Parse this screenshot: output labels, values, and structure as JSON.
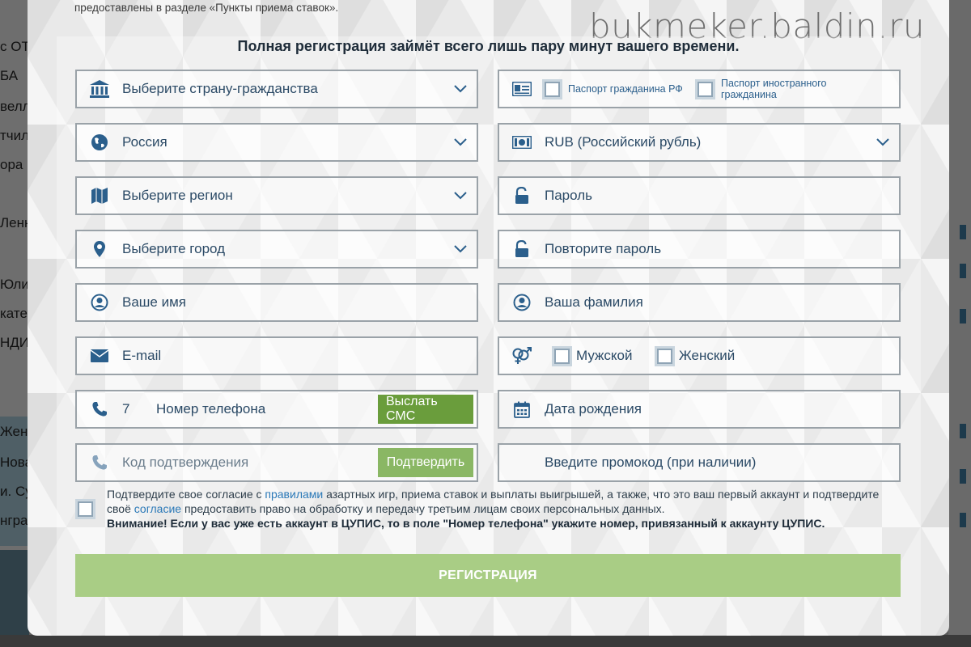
{
  "watermark": "bukmeker.baldin.ru",
  "info_text": "предоставлены в разделе «Пункты приема ставок».",
  "title": "Полная регистрация займёт всего лишь пару минут вашего времени.",
  "background_fragments": [
    "с ОТ",
    "БА",
    "велл",
    "тчил",
    "ора",
    "Ленн",
    "Юли",
    "катер",
    "НДИ",
    "Жен",
    "Нова",
    "и. Су",
    "нгра"
  ],
  "left_fields": {
    "country": "Выберите страну-гражданства",
    "russia": "Россия",
    "region": "Выберите регион",
    "city": "Выберите город",
    "name": "Ваше имя",
    "email": "E-mail",
    "phone_prefix": "7",
    "phone": "Номер телефона",
    "send_sms": "Выслать СМС",
    "code": "Код подтверждения",
    "confirm": "Подтвердить"
  },
  "right_fields": {
    "passport_rf": "Паспорт гражданина РФ",
    "passport_foreign": "Паспорт иностранного гражданина",
    "currency": "RUB (Российский рубль)",
    "password": "Пароль",
    "repeat_password": "Повторите пароль",
    "surname": "Ваша фамилия",
    "male": "Мужской",
    "female": "Женский",
    "birthdate": "Дата рождения",
    "promo": "Введите промокод (при наличии)"
  },
  "agreement": {
    "part1": "Подтвердите свое согласие с ",
    "link_rules": "правилами",
    "part2": " азартных игр, приема ставок и выплаты выигрышей, а также, что это ваш первый аккаунт и подтвердите своё ",
    "link_consent": "согласие",
    "part3": " предоставить право на обработку и передачу третьим лицам своих персональных данных.",
    "warning": "Внимание! Если у вас уже есть аккаунт в ЦУПИС, то в поле \"Номер телефона\" укажите номер, привязанный к аккаунту ЦУПИС."
  },
  "register_button": "РЕГИСТРАЦИЯ",
  "colors": {
    "icon": "#2b5f8c",
    "green_button": "#6a9d3c",
    "register_button": "#a9cd85"
  }
}
